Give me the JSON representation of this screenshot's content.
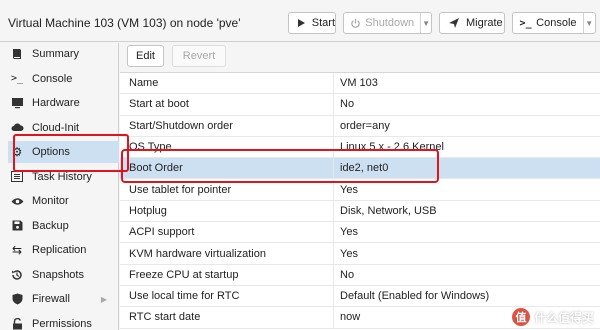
{
  "header": {
    "title": "Virtual Machine 103 (VM 103) on node 'pve'",
    "buttons": {
      "start": "Start",
      "shutdown": "Shutdown",
      "migrate": "Migrate",
      "console": "Console"
    }
  },
  "sidebar": {
    "items": [
      {
        "label": "Summary",
        "icon": "book-icon"
      },
      {
        "label": "Console",
        "icon": "terminal-icon"
      },
      {
        "label": "Hardware",
        "icon": "monitor-icon"
      },
      {
        "label": "Cloud-Init",
        "icon": "cloud-icon"
      },
      {
        "label": "Options",
        "icon": "gear-icon",
        "active": true
      },
      {
        "label": "Task History",
        "icon": "list-icon"
      },
      {
        "label": "Monitor",
        "icon": "eye-icon"
      },
      {
        "label": "Backup",
        "icon": "floppy-icon"
      },
      {
        "label": "Replication",
        "icon": "retweet-icon"
      },
      {
        "label": "Snapshots",
        "icon": "history-icon"
      },
      {
        "label": "Firewall",
        "icon": "shield-icon"
      },
      {
        "label": "Permissions",
        "icon": "unlock-icon"
      }
    ]
  },
  "toolbar": {
    "edit_label": "Edit",
    "revert_label": "Revert"
  },
  "options": {
    "rows": [
      {
        "key": "Name",
        "value": "VM 103"
      },
      {
        "key": "Start at boot",
        "value": "No"
      },
      {
        "key": "Start/Shutdown order",
        "value": "order=any"
      },
      {
        "key": "OS Type",
        "value": "Linux 5.x - 2.6 Kernel"
      },
      {
        "key": "Boot Order",
        "value": "ide2, net0",
        "selected": true
      },
      {
        "key": "Use tablet for pointer",
        "value": "Yes"
      },
      {
        "key": "Hotplug",
        "value": "Disk, Network, USB"
      },
      {
        "key": "ACPI support",
        "value": "Yes"
      },
      {
        "key": "KVM hardware virtualization",
        "value": "Yes"
      },
      {
        "key": "Freeze CPU at startup",
        "value": "No"
      },
      {
        "key": "Use local time for RTC",
        "value": "Default (Enabled for Windows)"
      },
      {
        "key": "RTC start date",
        "value": "now"
      }
    ]
  },
  "watermark": {
    "badge": "值",
    "text": "什么值得买"
  },
  "colors": {
    "selection": "#cde0f1",
    "annotation": "#e0141e"
  }
}
